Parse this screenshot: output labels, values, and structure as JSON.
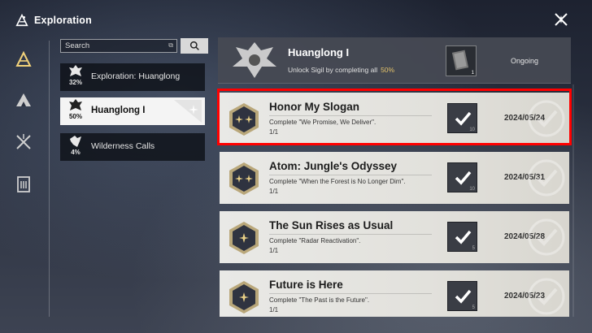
{
  "app": {
    "title": "Exploration"
  },
  "search": {
    "placeholder": "Search"
  },
  "categories": [
    {
      "name": "Exploration: Huanglong",
      "pct": "32%",
      "state": "dark"
    },
    {
      "name": "Huanglong I",
      "pct": "50%",
      "state": "active"
    },
    {
      "name": "Wilderness Calls",
      "pct": "4%",
      "state": "dark"
    }
  ],
  "header": {
    "title": "Huanglong I",
    "subtitle": "Unlock Sigil by completing all",
    "progress": "50%",
    "reward_count": "1",
    "status": "Ongoing"
  },
  "quests": [
    {
      "title": "Honor My Slogan",
      "desc": "Complete \"We Promise, We Deliver\".",
      "count": "1/1",
      "reward_num": "10",
      "date": "2024/05/24",
      "stars": 2
    },
    {
      "title": "Atom: Jungle's Odyssey",
      "desc": "Complete \"When the Forest is No Longer Dim\".",
      "count": "1/1",
      "reward_num": "10",
      "date": "2024/05/31",
      "stars": 2
    },
    {
      "title": "The Sun Rises as Usual",
      "desc": "Complete \"Radar Reactivation\".",
      "count": "1/1",
      "reward_num": "5",
      "date": "2024/05/28",
      "stars": 1
    },
    {
      "title": "Future is Here",
      "desc": "Complete \"The Past is the Future\".",
      "count": "1/1",
      "reward_num": "5",
      "date": "2024/05/23",
      "stars": 1
    }
  ],
  "colors": {
    "highlight": "#ff0000",
    "progress": "#e3c26a",
    "active_category": "#f4f4f4"
  }
}
